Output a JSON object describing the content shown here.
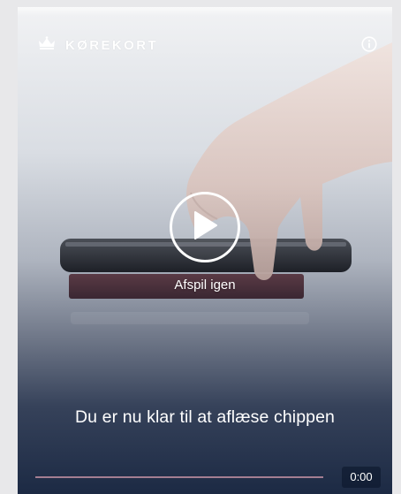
{
  "header": {
    "brand_text": "KØREKORT",
    "crown_icon": "crown-icon",
    "info_icon": "info-icon"
  },
  "player": {
    "play_icon": "play-icon",
    "replay_label": "Afspil igen",
    "caption": "Du er nu klar til at aflæse chippen",
    "current_time": "0:00",
    "progress": 0
  },
  "colors": {
    "accent": "#a47e92",
    "text": "#ffffff",
    "background_bottom": "#1c2a44"
  }
}
